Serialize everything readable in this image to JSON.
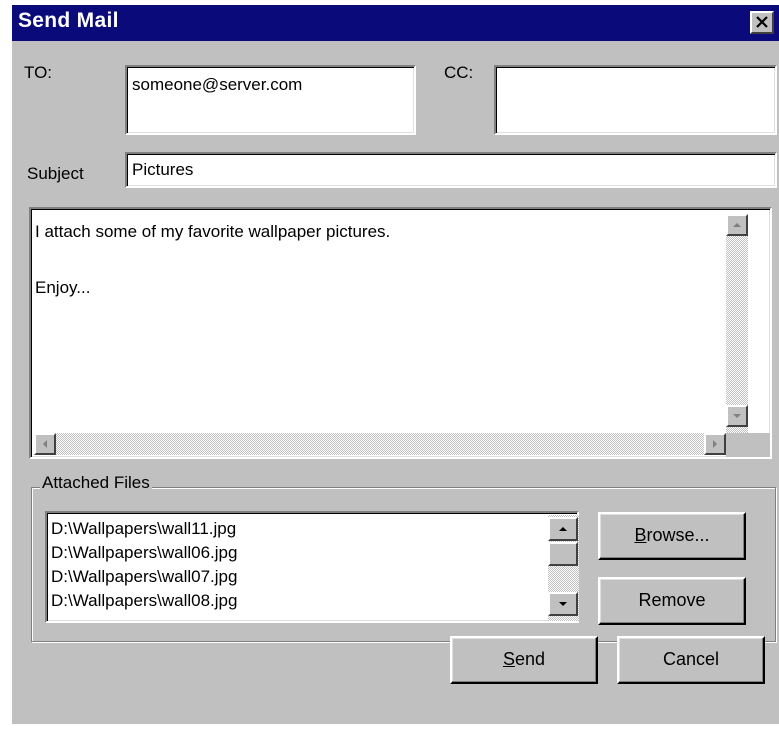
{
  "window": {
    "title": "Send Mail",
    "close_icon": "close-icon"
  },
  "fields": {
    "to_label": "TO:",
    "to_value": "someone@server.com",
    "cc_label": "CC:",
    "cc_value": "",
    "subject_label": "Subject",
    "subject_value": "Pictures"
  },
  "message": {
    "body": "I attach some of my favorite wallpaper pictures.\n\nEnjoy..."
  },
  "attachments": {
    "group_label": "Attached Files",
    "files": [
      "D:\\Wallpapers\\wall11.jpg",
      "D:\\Wallpapers\\wall06.jpg",
      "D:\\Wallpapers\\wall07.jpg",
      "D:\\Wallpapers\\wall08.jpg"
    ],
    "browse_label": {
      "mnemonic": "B",
      "rest": "rowse..."
    },
    "remove_label": "Remove"
  },
  "actions": {
    "send_label": {
      "mnemonic": "S",
      "rest": "end"
    },
    "cancel_label": "Cancel"
  },
  "colors": {
    "title_bar": "#0a0a7a",
    "dialog_face": "#c0c0c0",
    "field_bg": "#ffffff"
  }
}
